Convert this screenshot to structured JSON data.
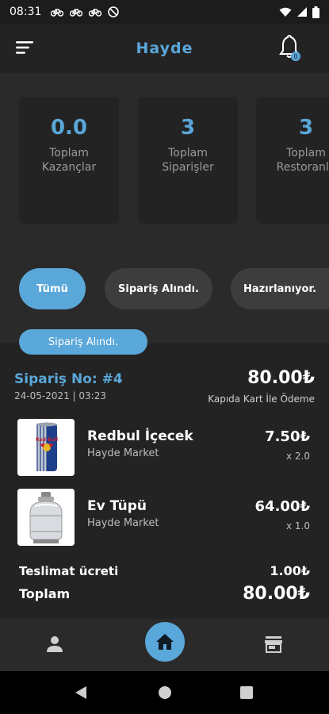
{
  "status_bar": {
    "time": "08:31",
    "icons": [
      "bicycle-icon",
      "bicycle-icon",
      "bicycle-icon",
      "do-not-disturb-icon"
    ],
    "right_icons": [
      "wifi-icon",
      "signal-icon",
      "battery-icon"
    ]
  },
  "app_bar": {
    "title": "Hayde",
    "menu_icon": "menu-icon",
    "bell_icon": "bell-icon"
  },
  "stats": [
    {
      "value": "0.0",
      "label_line1": "Toplam",
      "label_line2": "Kazançlar"
    },
    {
      "value": "3",
      "label_line1": "Toplam",
      "label_line2": "Siparişler"
    },
    {
      "value": "3",
      "label_line1": "Toplam",
      "label_line2": "Restoranlo"
    }
  ],
  "filters": [
    {
      "label": "Tümü",
      "active": true
    },
    {
      "label": "Sipariş Alındı.",
      "active": false
    },
    {
      "label": "Hazırlanıyor.",
      "active": false
    }
  ],
  "order": {
    "status": "Sipariş Alındı.",
    "number": "Sipariş No: #4",
    "date": "24-05-2021 | 03:23",
    "total": "80.00₺",
    "payment": "Kapıda Kart İle Ödeme",
    "items": [
      {
        "name": "Redbul İçecek",
        "store": "Hayde Market",
        "price": "7.50₺",
        "qty": "x 2.0",
        "image": "redbull-can"
      },
      {
        "name": "Ev Tüpü",
        "store": "Hayde Market",
        "price": "64.00₺",
        "qty": "x 1.0",
        "image": "gas-cylinder"
      }
    ],
    "delivery_label": "Teslimat ücreti",
    "delivery_value": "1.00₺",
    "total_label": "Toplam",
    "total_value": "80.00₺"
  },
  "bottom_nav": {
    "left_icon": "person-icon",
    "center_icon": "home-icon",
    "right_icon": "store-icon"
  },
  "system_nav": [
    "back-icon",
    "home-circle-icon",
    "recents-icon"
  ],
  "colors": {
    "accent": "#5aa7d9",
    "background": "#232323",
    "panel": "#2a2a2a",
    "chip": "#3d3d3d"
  }
}
